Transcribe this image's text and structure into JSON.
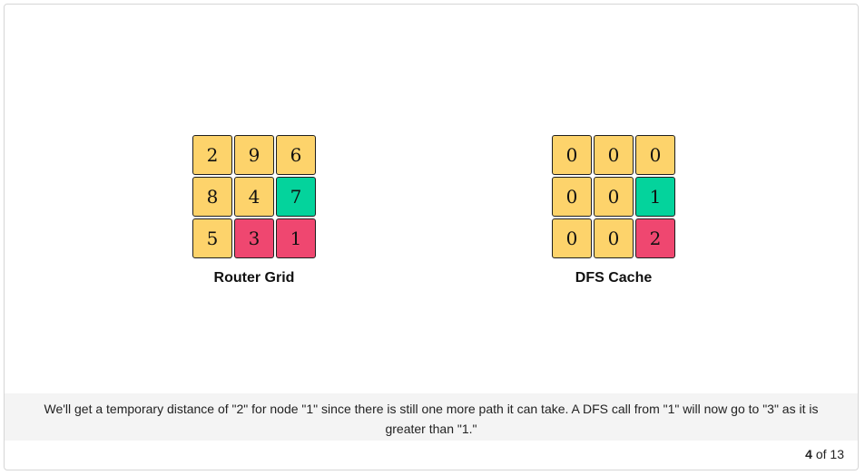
{
  "router_grid": {
    "caption": "Router Grid",
    "cells": [
      {
        "value": "2",
        "color": "yellow"
      },
      {
        "value": "9",
        "color": "yellow"
      },
      {
        "value": "6",
        "color": "yellow"
      },
      {
        "value": "8",
        "color": "yellow"
      },
      {
        "value": "4",
        "color": "yellow"
      },
      {
        "value": "7",
        "color": "green"
      },
      {
        "value": "5",
        "color": "yellow"
      },
      {
        "value": "3",
        "color": "red"
      },
      {
        "value": "1",
        "color": "red"
      }
    ]
  },
  "dfs_cache": {
    "caption": "DFS Cache",
    "cells": [
      {
        "value": "0",
        "color": "yellow"
      },
      {
        "value": "0",
        "color": "yellow"
      },
      {
        "value": "0",
        "color": "yellow"
      },
      {
        "value": "0",
        "color": "yellow"
      },
      {
        "value": "0",
        "color": "yellow"
      },
      {
        "value": "1",
        "color": "green"
      },
      {
        "value": "0",
        "color": "yellow"
      },
      {
        "value": "0",
        "color": "yellow"
      },
      {
        "value": "2",
        "color": "red"
      }
    ]
  },
  "colors": {
    "yellow": "#fdd36b",
    "green": "#04d39c",
    "red": "#ef4770"
  },
  "description": "We'll get a temporary distance of \"2\" for node \"1\" since there is still one more path it can take. A DFS call from \"1\" will now go to \"3\" as it is greater than \"1.\"",
  "pager": {
    "current": "4",
    "separator": "of",
    "total": "13"
  }
}
